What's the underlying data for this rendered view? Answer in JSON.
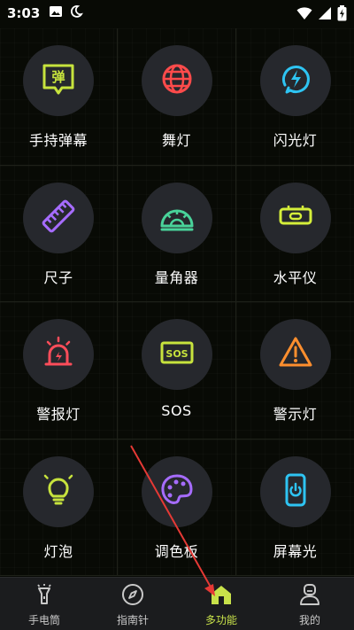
{
  "status_bar": {
    "time": "3:03",
    "left_icons": [
      "image-icon",
      "moon-icon"
    ],
    "right_icons": [
      "wifi-icon",
      "signal-icon",
      "battery-charging-icon"
    ]
  },
  "colors": {
    "background": "#080a05",
    "circle": "#26282d",
    "nav_background": "#1b1c1e",
    "nav_active": "#c8e24a"
  },
  "grid": {
    "items": [
      {
        "label": "手持弹幕",
        "icon": "danmaku-icon",
        "icon_text": "弹",
        "color": "#c7e33d"
      },
      {
        "label": "舞灯",
        "icon": "disco-ball-icon",
        "color": "#ff4b4b"
      },
      {
        "label": "闪光灯",
        "icon": "flash-icon",
        "color": "#2ec4f2"
      },
      {
        "label": "尺子",
        "icon": "ruler-icon",
        "color": "#a66cff"
      },
      {
        "label": "量角器",
        "icon": "protractor-icon",
        "color": "#49d39a"
      },
      {
        "label": "水平仪",
        "icon": "level-icon",
        "color": "#d5ef3a"
      },
      {
        "label": "警报灯",
        "icon": "alarm-light-icon",
        "color": "#ff4d5a"
      },
      {
        "label": "SOS",
        "icon": "sos-icon",
        "icon_text": "SOS",
        "color": "#c7e33d"
      },
      {
        "label": "警示灯",
        "icon": "warning-icon",
        "color": "#ff8f2e"
      },
      {
        "label": "灯泡",
        "icon": "bulb-icon",
        "color": "#c7e33d"
      },
      {
        "label": "调色板",
        "icon": "palette-icon",
        "color": "#a66cff"
      },
      {
        "label": "屏幕光",
        "icon": "phone-screen-icon",
        "color": "#2ec4f2"
      }
    ]
  },
  "bottom_nav": {
    "items": [
      {
        "label": "手电筒",
        "icon": "flashlight-icon",
        "active": false
      },
      {
        "label": "指南针",
        "icon": "compass-icon",
        "active": false
      },
      {
        "label": "多功能",
        "icon": "home-icon",
        "active": true
      },
      {
        "label": "我的",
        "icon": "profile-icon",
        "active": false
      }
    ]
  },
  "annotation": {
    "arrow_color": "#e53935"
  }
}
